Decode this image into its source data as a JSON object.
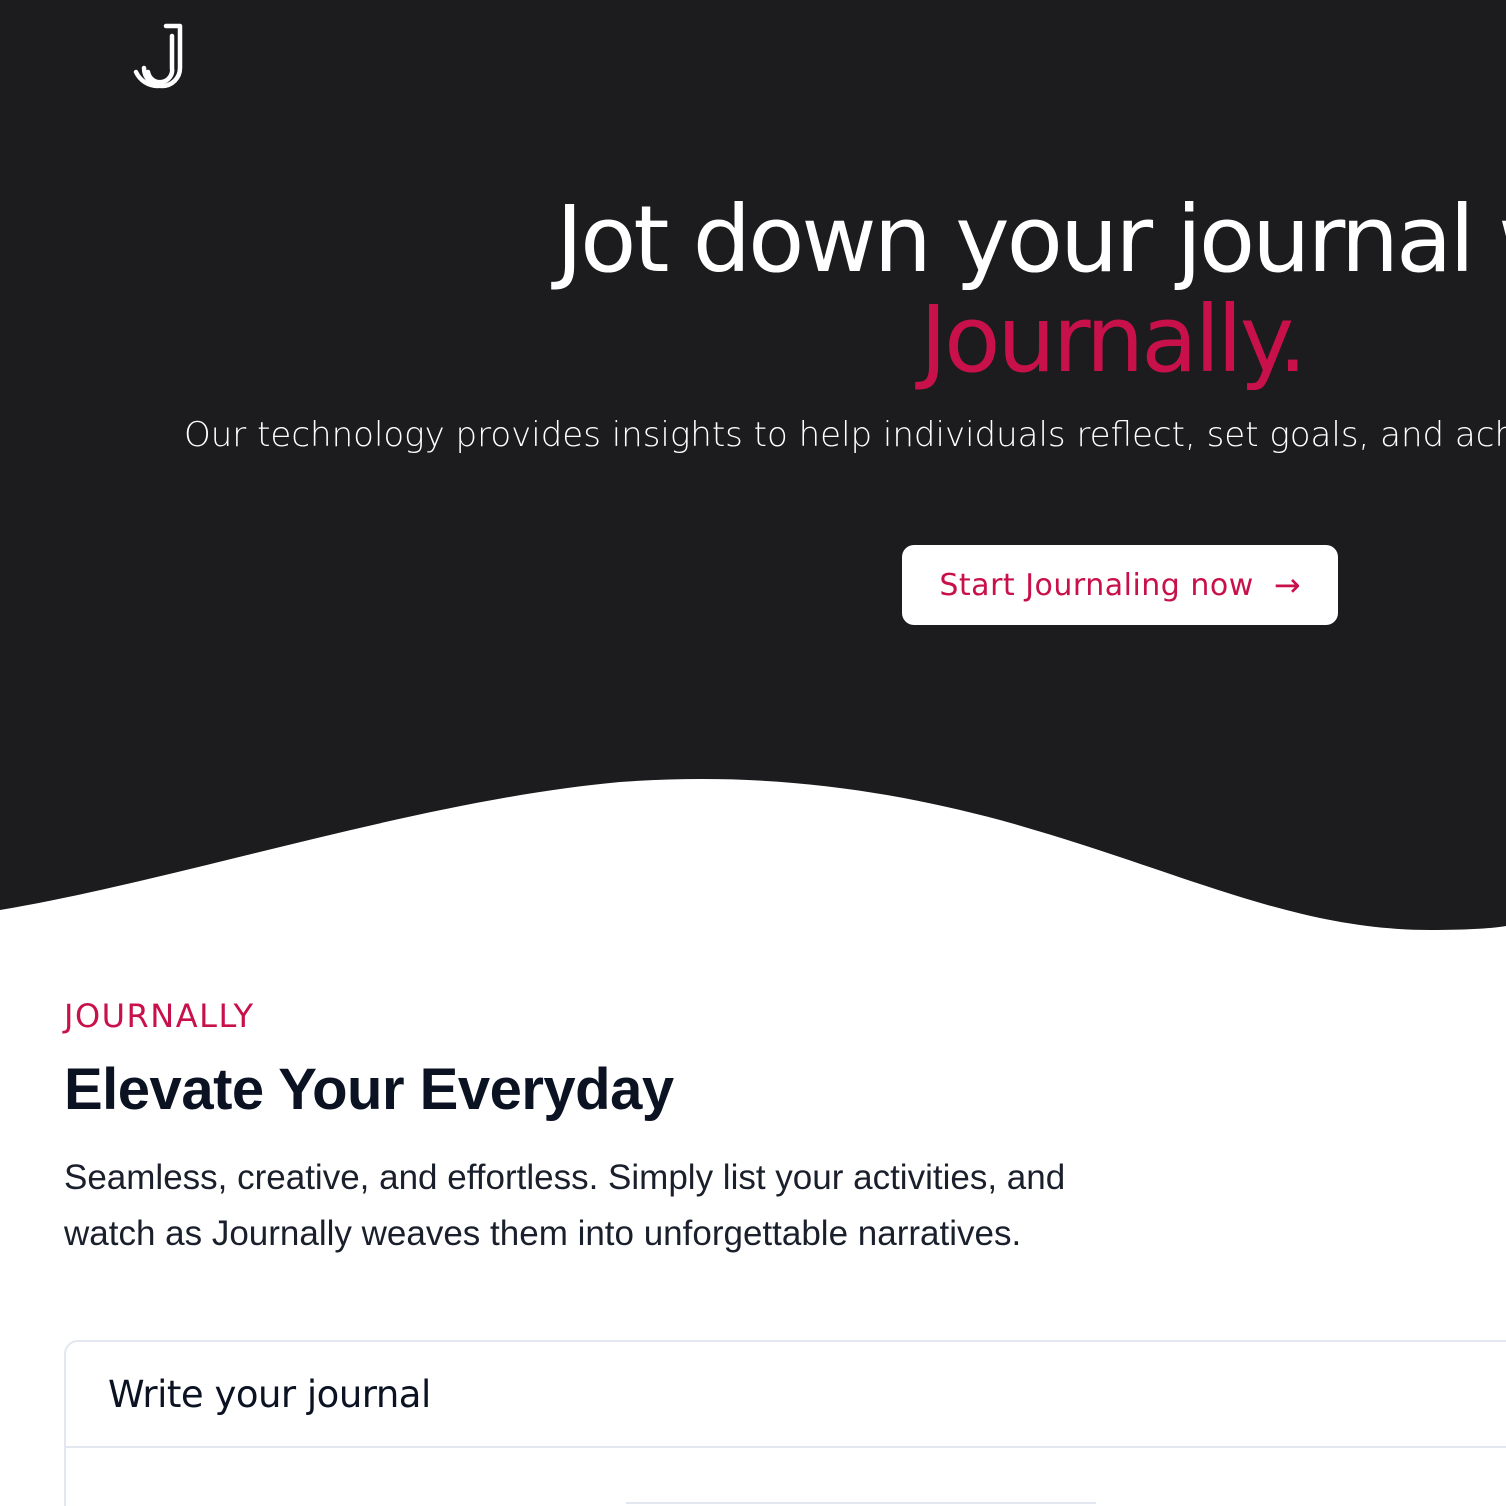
{
  "colors": {
    "hero_bg": "#1c1c1e",
    "accent": "#c8114a",
    "heading": "#0b1222",
    "border": "#e3e7ef"
  },
  "header": {
    "logo_icon": "journally-j-logo"
  },
  "hero": {
    "title": "Jot down your journal w",
    "brand": "Journally.",
    "subtitle": "Our technology provides insights to help individuals reflect, set goals, and achi",
    "cta_label": "Start Journaling now",
    "cta_icon": "arrow-right-icon",
    "cta_arrow": "→"
  },
  "features": {
    "eyebrow": "JOURNALLY",
    "title": "Elevate Your Everyday",
    "description": "Seamless, creative, and effortless. Simply list your activities, and watch as Journally weaves them into unforgettable narratives."
  },
  "journal_card": {
    "title": "Write your journal"
  }
}
